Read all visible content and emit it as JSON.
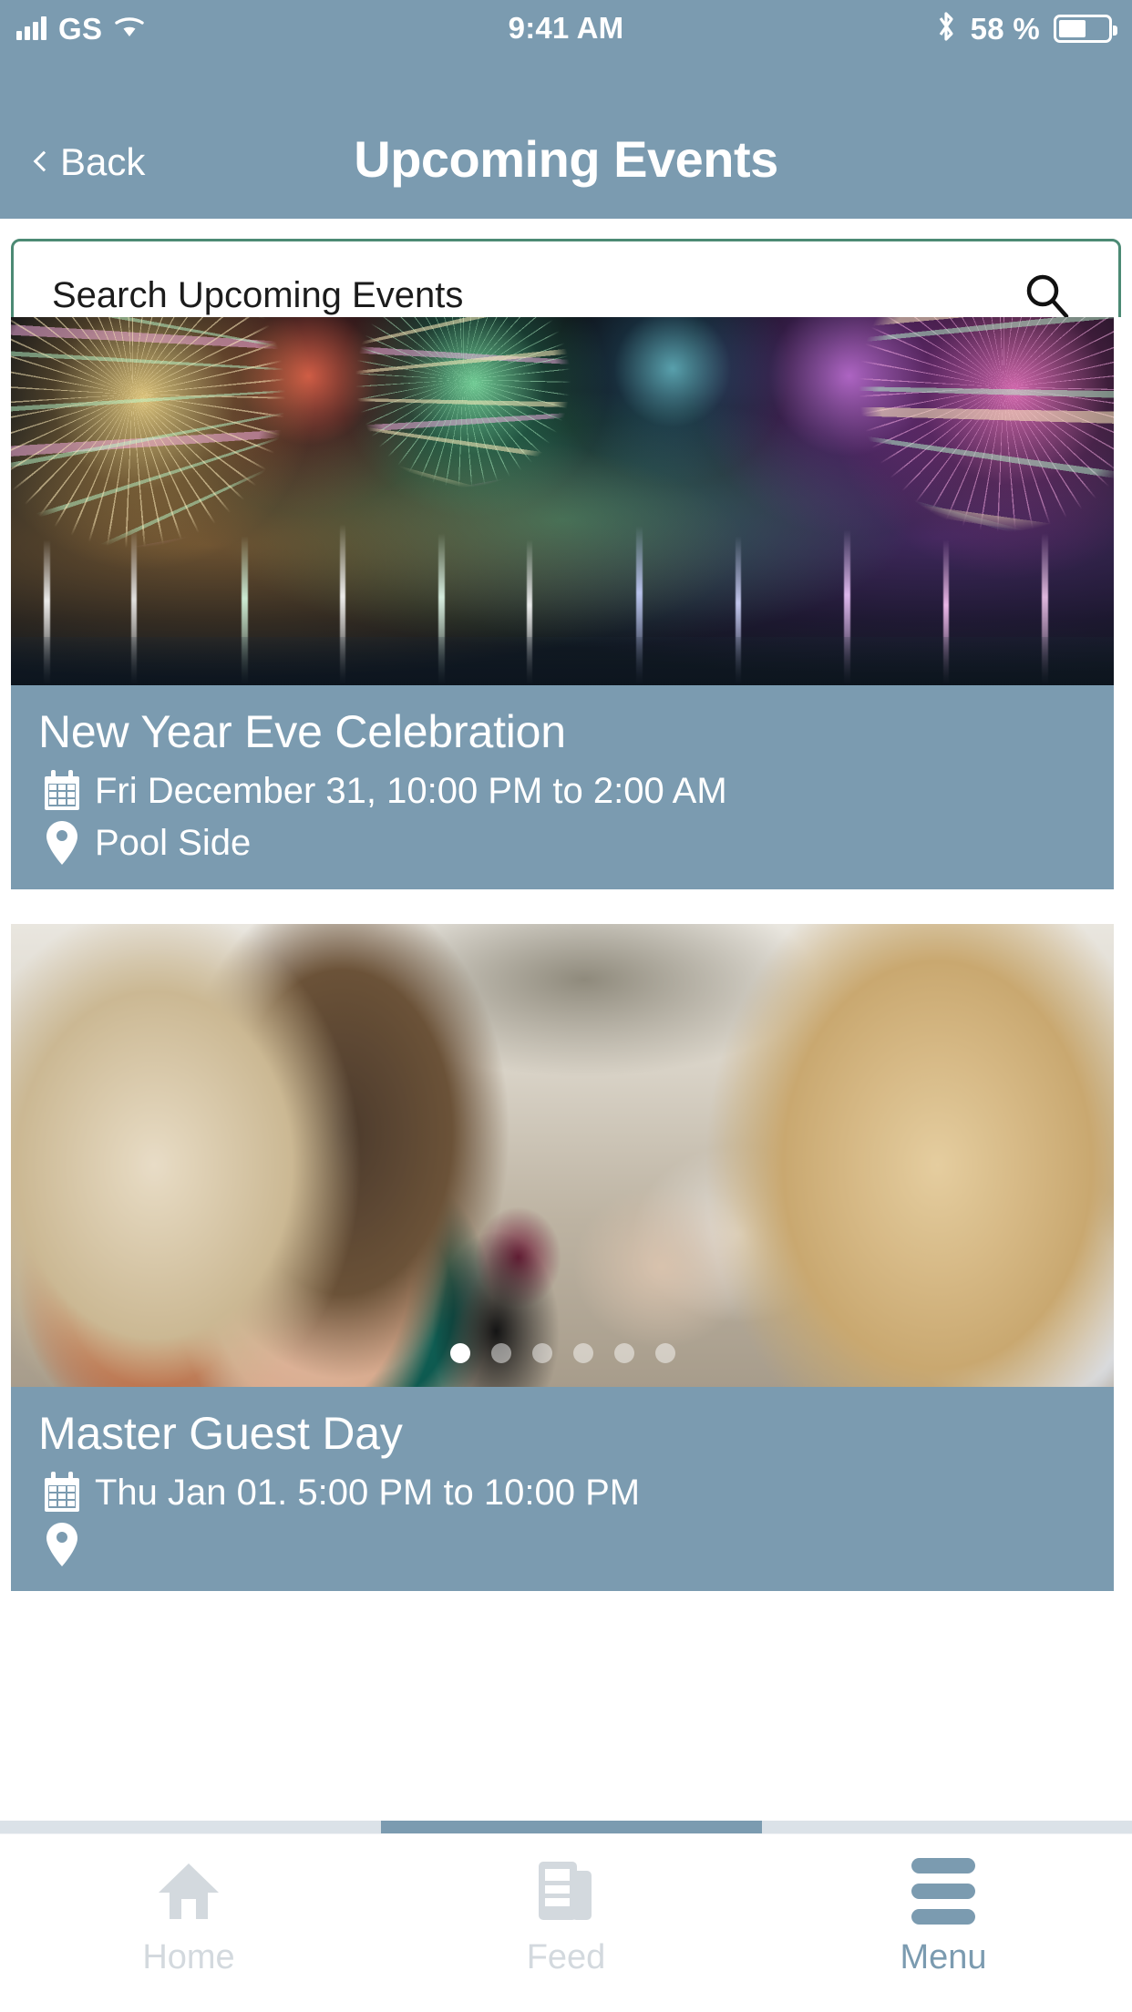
{
  "status_bar": {
    "carrier": "GS",
    "time": "9:41 AM",
    "battery_percent": "58 %",
    "signal_icon": "signal-bars-icon",
    "wifi_icon": "wifi-icon",
    "bluetooth_icon": "bluetooth-icon",
    "battery_icon": "battery-icon"
  },
  "nav": {
    "back_label": "Back",
    "title": "Upcoming Events"
  },
  "search": {
    "placeholder": "Search Upcoming Events",
    "value": "",
    "icon": "search-icon",
    "border_color": "#4c8a74"
  },
  "theme": {
    "accent": "#7b9bb0",
    "caption_bg": "#7b9bb0",
    "search_border": "#4c8a74",
    "inactive_tab": "#d3d9de"
  },
  "events": [
    {
      "title": "New Year Eve Celebration",
      "date": "Fri December 31, 10:00 PM to 2:00 AM",
      "location": "Pool Side",
      "date_icon": "calendar-icon",
      "location_icon": "map-pin-icon",
      "image_alt": "fireworks-over-water"
    },
    {
      "title": "Master Guest Day",
      "date": "Thu Jan 01. 5:00 PM to 10:00 PM",
      "location": "",
      "date_icon": "calendar-icon",
      "location_icon": "map-pin-icon",
      "image_alt": "guests-at-party",
      "carousel": {
        "total": 6,
        "active": 1
      }
    }
  ],
  "tabs": [
    {
      "label": "Home",
      "icon": "home-icon",
      "active": false
    },
    {
      "label": "Feed",
      "icon": "feed-icon",
      "active": false
    },
    {
      "label": "Menu",
      "icon": "hamburger-menu-icon",
      "active": true
    }
  ]
}
